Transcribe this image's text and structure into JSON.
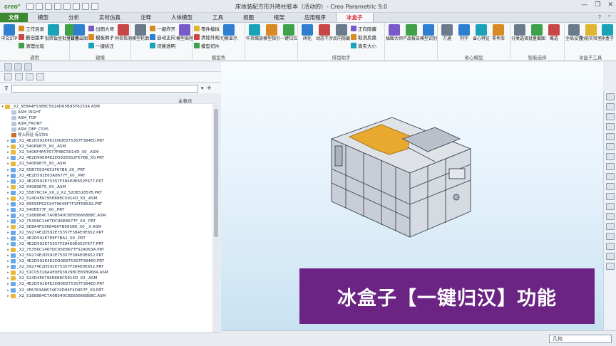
{
  "app": {
    "logo": "creo°",
    "window_title": "床体装配方形升降柱脏本（活动的）- Creo Parametric 9.0",
    "controls": [
      "—",
      "❐",
      "✕"
    ]
  },
  "menu_tabs": [
    "文件",
    "模型",
    "分析",
    "实时仿真",
    "注释",
    "人体模型",
    "工具",
    "视图",
    "框架",
    "应用程序",
    "冰盒子"
  ],
  "active_tab": "冰盒子",
  "ribbon": {
    "groups": [
      {
        "label": "通用",
        "bigs": [
          "中文STP"
        ],
        "smalls": [
          "工作目录",
          "删旧版本",
          "清理垃圾"
        ],
        "bigs2": [
          "批转钣金",
          "批量转换"
        ]
      },
      {
        "label": "建模",
        "bigs": [
          "钣金出图"
        ],
        "smalls": [
          "出图大师",
          "模板刷子",
          "一键拆迁"
        ],
        "bigs2": [
          "同名检测"
        ]
      },
      {
        "label": "",
        "bigs": [
          "模型轮廓"
        ],
        "smalls": [
          "一键炸开",
          "自动正向",
          "切换透明"
        ],
        "bigs2": [
          "模型高程"
        ]
      },
      {
        "label": "模型秀",
        "bigs": [],
        "smalls": [
          "零件模拟",
          "清除外观",
          "模型切片"
        ],
        "bigs2": [
          "切换显示"
        ]
      },
      {
        "label": "",
        "bigs": [
          "中央缩放",
          "模型指引",
          "一键归位"
        ],
        "smalls": [],
        "bigs2": []
      },
      {
        "label": "排齿助手",
        "bigs": [
          "阀化",
          "动态干涉",
          "反向隐藏"
        ],
        "smalls": [
          "正向隐藏",
          "取消反路",
          "真实大小"
        ],
        "bigs2": []
      },
      {
        "label": "",
        "bigs": [
          "插图大师",
          "产品报告",
          "模型识别"
        ],
        "smalls": [],
        "bigs2": []
      },
      {
        "label": "省心模型",
        "bigs": [
          "方通",
          "列字",
          "省心特征",
          "零件库"
        ],
        "smalls": [],
        "bigs2": []
      },
      {
        "label": "智能选择",
        "bigs": [
          "分类选择",
          "批量截图",
          "概选"
        ],
        "smalls": [],
        "bigs2": []
      },
      {
        "label": "冰盒子工具",
        "bigs": [
          "全局设置",
          "功能实验室",
          "冰盒子"
        ],
        "smalls": [],
        "bigs2": []
      }
    ]
  },
  "navigator": {
    "filter_placeholder": "",
    "show_label": "主表示",
    "root": "_X2_5E8A4F5388C5914D65B95F62534.ASM",
    "datums": [
      "ASM_RIGHT",
      "ASM_TOP",
      "ASM_FRONT",
      "ASM_DEF_CSYS"
    ],
    "feature": "导入特征 标识55",
    "items": [
      {
        "t": "prt",
        "n": "_X2_4E2D592E4E2D90E875357F384E0.PRT"
      },
      {
        "t": "asm",
        "n": "_X2_54089875_X0_.ASM"
      },
      {
        "t": "asm",
        "n": "_X2_5406F4FA7677F88C5914D_X0_.ASM"
      },
      {
        "t": "prt",
        "n": "_X2_4E2D90E84E2D592E652F67B6_X0.PRT"
      },
      {
        "t": "asm",
        "n": "_X2_54089875_X0_.ASM"
      },
      {
        "t": "prt",
        "n": "_X2_55B75934652F67B6_X0_.PRT"
      },
      {
        "t": "prt",
        "n": "_X2_4E2D592E63A8677F_X0_.PRT"
      },
      {
        "t": "prt",
        "n": "_X2_4E2D592E75357F384E0E652F677.PRT"
      },
      {
        "t": "asm",
        "n": "_X2_54089875_X0_.ASM"
      },
      {
        "t": "prt",
        "n": "_X2_55B76C34_X0_2_X2_52065185?B.PRT"
      },
      {
        "t": "asm",
        "n": "_X2_524D4FA795E888C5914D_X0_.ASM"
      },
      {
        "t": "prt",
        "n": "_X2_65E95F6253479649F7F1FF08592.PRT"
      },
      {
        "t": "prt",
        "n": "_X2_540E677F_X0_.PRT"
      },
      {
        "t": "prt",
        "n": "_X2_5168884C7A0B540C6E65666888C.ASM"
      },
      {
        "t": "prt",
        "n": "_X2_75356C146TDC95E8677F_X0_.PRT"
      },
      {
        "t": "asm",
        "n": "_X2_5E8A4F5368466TB665B0_X0__X.ASM"
      },
      {
        "t": "prt",
        "n": "_X2_59274E2D592E75357F384E0E652.PRT"
      },
      {
        "t": "prt",
        "n": "_X2_4E2D592E7EEF7BA1_X0_.PRT"
      },
      {
        "t": "prt",
        "n": "_X2_4E2D592E75357F384E0E652F677.PRT"
      },
      {
        "t": "asm",
        "n": "_X2_75356C146TDC95E867TF52A063A.PRT"
      },
      {
        "t": "prt",
        "n": "_X2_59274E2D592E75357F384E0E652.PRT"
      },
      {
        "t": "prt",
        "n": "_X2_4E2D592E4E2D90E875357F384E0.PRT"
      },
      {
        "t": "prt",
        "n": "_X2_59274E2D592E75357F384E0E652.PRT"
      },
      {
        "t": "asm",
        "n": "_X2_51C05316A4E0E639298CE65B9684.ASM"
      },
      {
        "t": "asm",
        "n": "_X2_524D4FA795E888C5914D_X0_.ASM"
      },
      {
        "t": "prt",
        "n": "_X2_4E2D592E4E2D90E875357F384E0.PRT"
      },
      {
        "t": "prt",
        "n": "_X2_4FA763A8674674D94F4D957F_X0.PRT"
      },
      {
        "t": "asm",
        "n": "_X2_5168884C7A0B540C6E65666888C.ASM"
      }
    ]
  },
  "banner": {
    "text": "冰盒子【一键归汉】功能",
    "color": "#6b2484"
  },
  "status": {
    "selection_filter": "几何"
  },
  "colors": {
    "file_tab": "#3b8a2f",
    "active_tab_text": "#dd3333",
    "model_highlight": "#e9a92f"
  }
}
